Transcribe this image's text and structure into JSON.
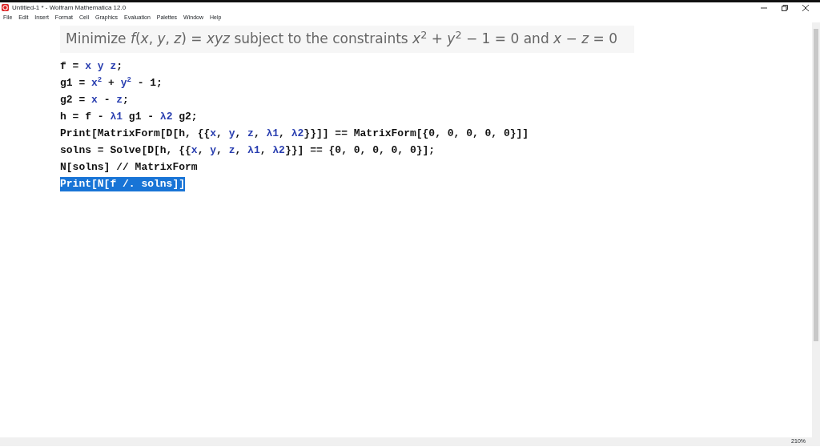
{
  "window": {
    "title": "Untitled-1 * - Wolfram Mathematica 12.0"
  },
  "menu": [
    "File",
    "Edit",
    "Insert",
    "Format",
    "Cell",
    "Graphics",
    "Evaluation",
    "Palettes",
    "Window",
    "Help"
  ],
  "title_cell": "Minimize *f*(*x*, *y*, *z*) = *xyz* subject to the constraints *x*$^{2}$ + *y*$^{2}$ − 1 = 0 and *x* − *z* = 0",
  "code_lines": [
    {
      "selected": false,
      "tokens": [
        {
          "kind": "code",
          "t": "f = "
        },
        {
          "kind": "var",
          "t": "x y z"
        },
        {
          "kind": "code",
          "t": ";"
        }
      ]
    },
    {
      "selected": false,
      "tokens": [
        {
          "kind": "code",
          "t": "g1 = "
        },
        {
          "kind": "var",
          "t": "x$^{2}$"
        },
        {
          "kind": "code",
          "t": " + "
        },
        {
          "kind": "var",
          "t": "y$^{2}$"
        },
        {
          "kind": "code",
          "t": " - 1;"
        }
      ]
    },
    {
      "selected": false,
      "tokens": [
        {
          "kind": "code",
          "t": "g2 = "
        },
        {
          "kind": "var",
          "t": "x"
        },
        {
          "kind": "code",
          "t": " - "
        },
        {
          "kind": "var",
          "t": "z"
        },
        {
          "kind": "code",
          "t": ";"
        }
      ]
    },
    {
      "selected": false,
      "tokens": [
        {
          "kind": "code",
          "t": "h = f - "
        },
        {
          "kind": "var",
          "t": "λ1"
        },
        {
          "kind": "code",
          "t": " g1 - "
        },
        {
          "kind": "var",
          "t": "λ2"
        },
        {
          "kind": "code",
          "t": " g2;"
        }
      ]
    },
    {
      "selected": false,
      "tokens": [
        {
          "kind": "code",
          "t": "Print[MatrixForm[D[h, {{"
        },
        {
          "kind": "var",
          "t": "x"
        },
        {
          "kind": "code",
          "t": ", "
        },
        {
          "kind": "var",
          "t": "y"
        },
        {
          "kind": "code",
          "t": ", "
        },
        {
          "kind": "var",
          "t": "z"
        },
        {
          "kind": "code",
          "t": ", "
        },
        {
          "kind": "var",
          "t": "λ1"
        },
        {
          "kind": "code",
          "t": ", "
        },
        {
          "kind": "var",
          "t": "λ2"
        },
        {
          "kind": "code",
          "t": "}}]] == MatrixForm[{0, 0, 0, 0, 0}]]"
        }
      ]
    },
    {
      "selected": false,
      "tokens": [
        {
          "kind": "code",
          "t": "solns = Solve[D[h, {{"
        },
        {
          "kind": "var",
          "t": "x"
        },
        {
          "kind": "code",
          "t": ", "
        },
        {
          "kind": "var",
          "t": "y"
        },
        {
          "kind": "code",
          "t": ", "
        },
        {
          "kind": "var",
          "t": "z"
        },
        {
          "kind": "code",
          "t": ", "
        },
        {
          "kind": "var",
          "t": "λ1"
        },
        {
          "kind": "code",
          "t": ", "
        },
        {
          "kind": "var",
          "t": "λ2"
        },
        {
          "kind": "code",
          "t": "}}] == {0, 0, 0, 0, 0}];"
        }
      ]
    },
    {
      "selected": false,
      "tokens": [
        {
          "kind": "code",
          "t": "N[solns] // MatrixForm"
        }
      ]
    },
    {
      "selected": true,
      "tokens": [
        {
          "kind": "code",
          "t": "Print[N[f /. solns]]"
        }
      ]
    }
  ],
  "status_bar": {
    "zoom": "210%"
  }
}
